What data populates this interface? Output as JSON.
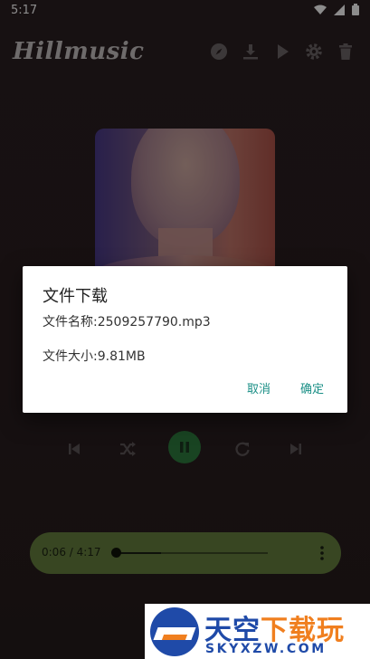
{
  "status_bar": {
    "time": "5:17",
    "icons": [
      "wifi-icon",
      "signal-icon",
      "battery-icon"
    ]
  },
  "app_bar": {
    "title": "Hillmusic",
    "actions": [
      "compass-icon",
      "download-icon",
      "play-icon",
      "settings-icon",
      "trash-icon"
    ]
  },
  "player": {
    "controls": [
      "skip-previous-icon",
      "shuffle-icon",
      "pause-icon",
      "repeat-icon",
      "skip-next-icon"
    ],
    "accent": "#2f7d3f"
  },
  "mini_player": {
    "time": "0:06 / 4:17",
    "progress": 0.02
  },
  "dialog": {
    "title": "文件下载",
    "file_name": "文件名称:2509257790.mp3",
    "file_size": "文件大小:9.81MB",
    "cancel_label": "取消",
    "confirm_label": "确定",
    "button_color": "#1a8f86"
  },
  "watermark": {
    "cn_part1": "天空",
    "cn_part2": "下载玩",
    "en": "SKYXZW.COM"
  }
}
